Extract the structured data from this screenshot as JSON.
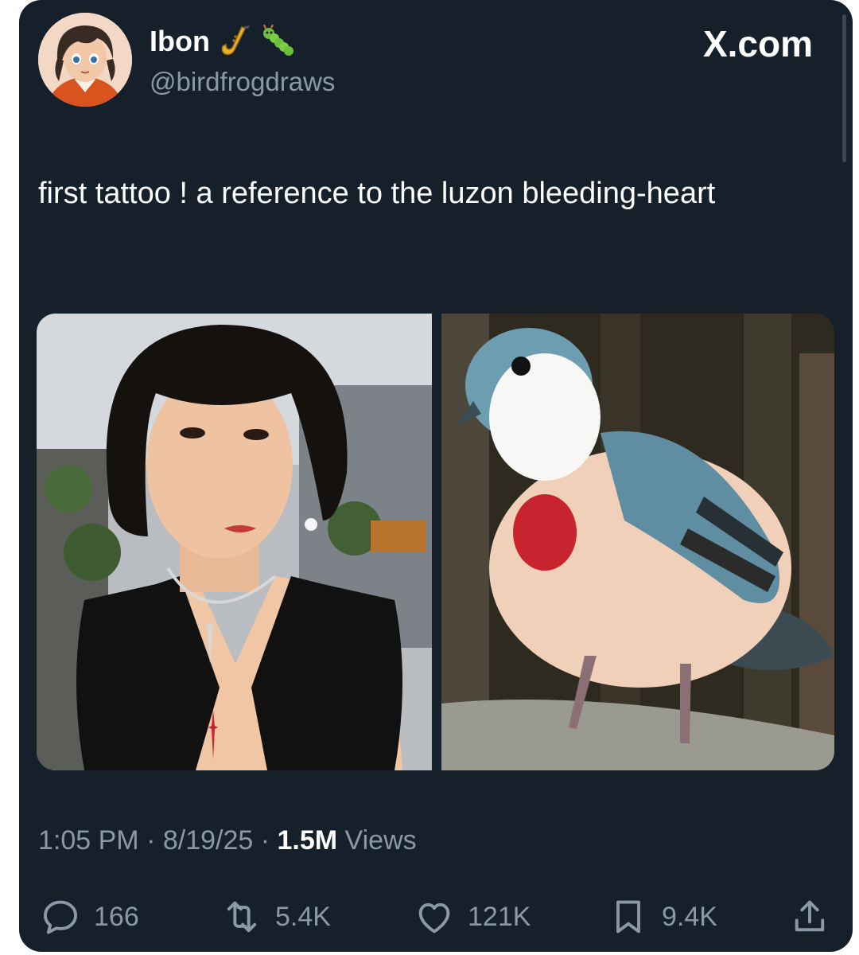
{
  "author": {
    "display_name": "Ibon",
    "handle": "@birdfrogdraws",
    "name_emojis": [
      "saxophone-icon",
      "caterpillar-icon"
    ]
  },
  "site": {
    "logo_text": "X.com"
  },
  "tweet": {
    "text": "first tattoo ! a reference to the luzon bleeding-heart",
    "media": [
      {
        "name": "photo-woman-tattoo"
      },
      {
        "name": "photo-luzon-bleeding-heart-dove"
      }
    ]
  },
  "meta": {
    "time": "1:05 PM",
    "separator": " · ",
    "date": "8/19/25",
    "views_count": "1.5M",
    "views_label": " Views"
  },
  "actions": {
    "replies": "166",
    "reposts": "5.4K",
    "likes": "121K",
    "bookmarks": "9.4K"
  },
  "colors": {
    "card_bg": "#15202b",
    "text_primary": "#ffffff",
    "text_secondary": "#8b98a5",
    "tattoo_red": "#c8242f"
  }
}
